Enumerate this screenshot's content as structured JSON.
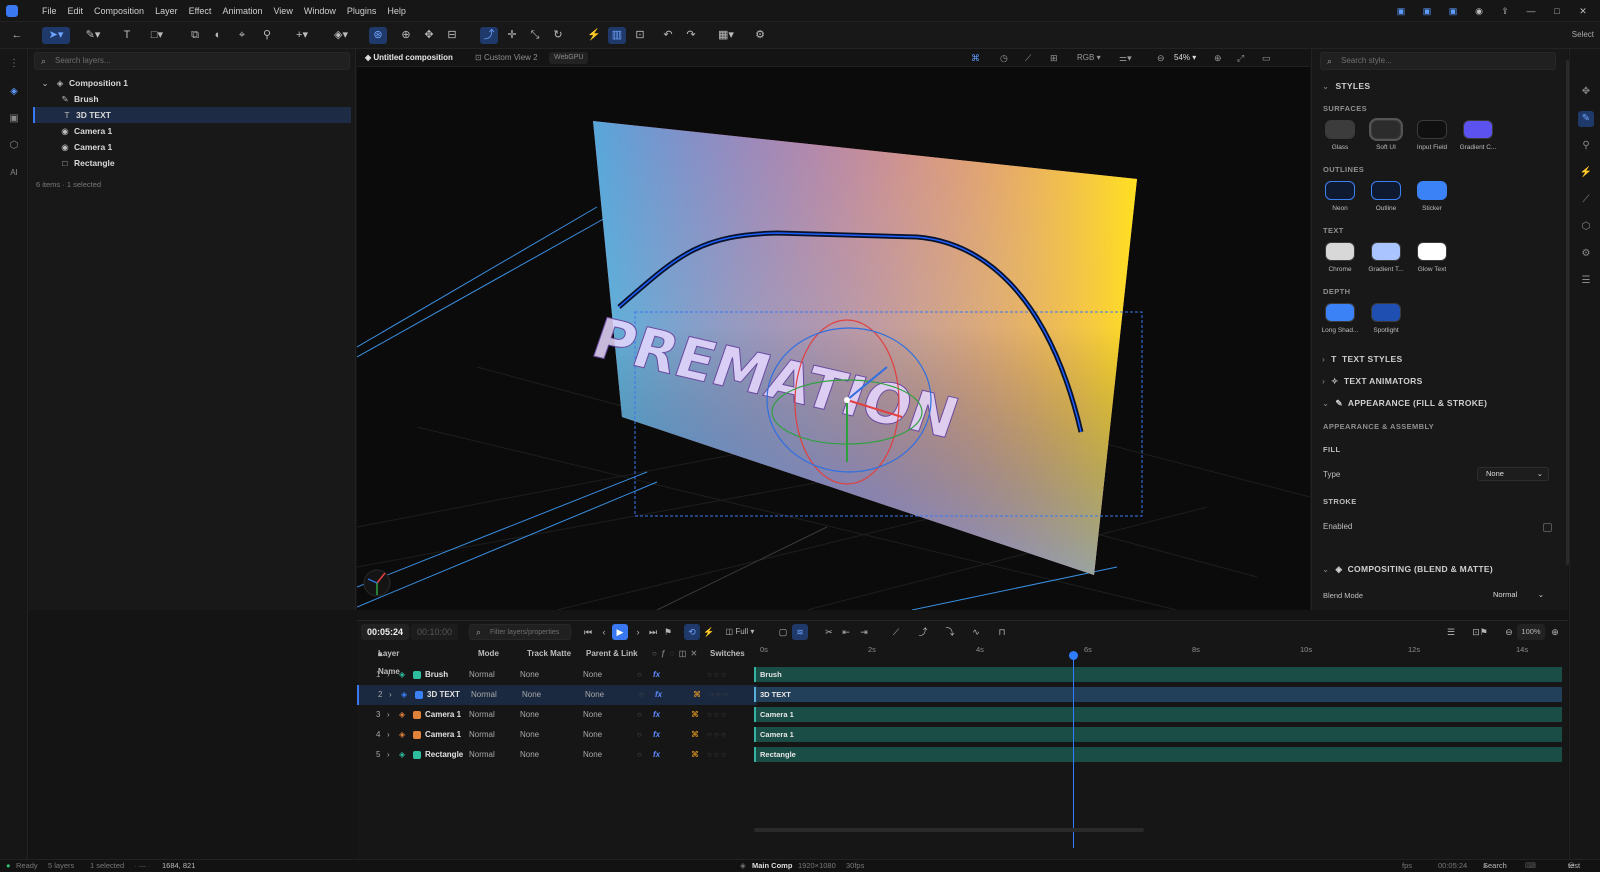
{
  "menubar": {
    "items": [
      "File",
      "Edit",
      "Composition",
      "Layer",
      "Effect",
      "Animation",
      "View",
      "Window",
      "Plugins",
      "Help"
    ],
    "select_label": "Select"
  },
  "layers_panel": {
    "search_placeholder": "Search layers...",
    "composition": "Composition 1",
    "items": [
      {
        "name": "Brush",
        "icon": "brush-icon",
        "glyph": "✎"
      },
      {
        "name": "3D TEXT",
        "icon": "text-icon",
        "glyph": "T"
      },
      {
        "name": "Camera 1",
        "icon": "camera-icon",
        "glyph": "◉"
      },
      {
        "name": "Camera 1",
        "icon": "camera-icon",
        "glyph": "◉"
      },
      {
        "name": "Rectangle",
        "icon": "rectangle-icon",
        "glyph": "□"
      }
    ],
    "count_text": "6 items",
    "selected_text": "1 selected"
  },
  "viewport": {
    "tab_active": "Untitled composition",
    "tab_view": "Custom View 2",
    "renderer": "WebGPU",
    "channel": "RGB",
    "zoom": "54%",
    "scene_text": "PREMATION"
  },
  "styles_panel": {
    "search_placeholder": "Search style...",
    "header": "STYLES",
    "surfaces_label": "SURFACES",
    "surfaces": [
      {
        "label": "Glass",
        "color": "#3c3c3c"
      },
      {
        "label": "Soft UI",
        "color": "#2c2c2c"
      },
      {
        "label": "Input Field",
        "color": "#101010"
      },
      {
        "label": "Gradient C...",
        "color": "#5b52f0"
      }
    ],
    "outlines_label": "OUTLINES",
    "outlines": [
      {
        "label": "Neon",
        "color": "#0f1a30"
      },
      {
        "label": "Outline",
        "color": "#0f1a30"
      },
      {
        "label": "Sticker",
        "color": "#3b82f6"
      }
    ],
    "text_label": "TEXT",
    "texts": [
      {
        "label": "Chrome",
        "color": "#d8d8d8"
      },
      {
        "label": "Gradient T...",
        "color": "#a9c4ff"
      },
      {
        "label": "Glow Text",
        "color": "#ffffff"
      }
    ],
    "depth_label": "DEPTH",
    "depths": [
      {
        "label": "Long Shad...",
        "color": "#3b82f6"
      },
      {
        "label": "Spotlight",
        "color": "#1f4fb0"
      }
    ],
    "text_styles": "TEXT STYLES",
    "text_animators": "TEXT ANIMATORS",
    "appearance": "APPEARANCE (FILL & STROKE)",
    "appearance_sub": "APPEARANCE & ASSEMBLY",
    "fill_label": "FILL",
    "type_label": "Type",
    "type_value": "None",
    "stroke_label": "STROKE",
    "enabled_label": "Enabled",
    "compositing": "COMPOSITING (BLEND & MATTE)",
    "blend_label": "Blend Mode",
    "blend_value": "Normal"
  },
  "timeline": {
    "timecode": "00:05:24",
    "timecode_dim": "00:10:00",
    "search_placeholder": "Filter layers/properties",
    "quality": "Full",
    "zoom": "100%",
    "columns": {
      "layer_name": "Layer Name",
      "mode": "Mode",
      "track_matte": "Track Matte",
      "parent": "Parent & Link",
      "switches": "Switches"
    },
    "ruler": [
      "0s",
      "2s",
      "4s",
      "6s",
      "8s",
      "10s",
      "12s",
      "14s"
    ],
    "layers": [
      {
        "index": "1",
        "name": "Brush",
        "mode": "Normal",
        "matte": "None",
        "parent": "None",
        "color": "#2fbf9f"
      },
      {
        "index": "2",
        "name": "3D TEXT",
        "mode": "Normal",
        "matte": "None",
        "parent": "None",
        "color": "#3b82f6"
      },
      {
        "index": "3",
        "name": "Camera 1",
        "mode": "Normal",
        "matte": "None",
        "parent": "None",
        "color": "#e0823a"
      },
      {
        "index": "4",
        "name": "Camera 1",
        "mode": "Normal",
        "matte": "None",
        "parent": "None",
        "color": "#e0823a"
      },
      {
        "index": "5",
        "name": "Rectangle",
        "mode": "Normal",
        "matte": "None",
        "parent": "None",
        "color": "#2fbf9f"
      }
    ],
    "playhead_seconds": 5.8
  },
  "status": {
    "ready": "Ready",
    "layers": "5 layers",
    "selected": "1 selected",
    "coords": "1684, 821",
    "comp": "Main Comp",
    "res": "1920×1080",
    "fps": "30fps",
    "fps_label": "fps",
    "time": "00:05:24",
    "search": "Search",
    "user": "test"
  }
}
